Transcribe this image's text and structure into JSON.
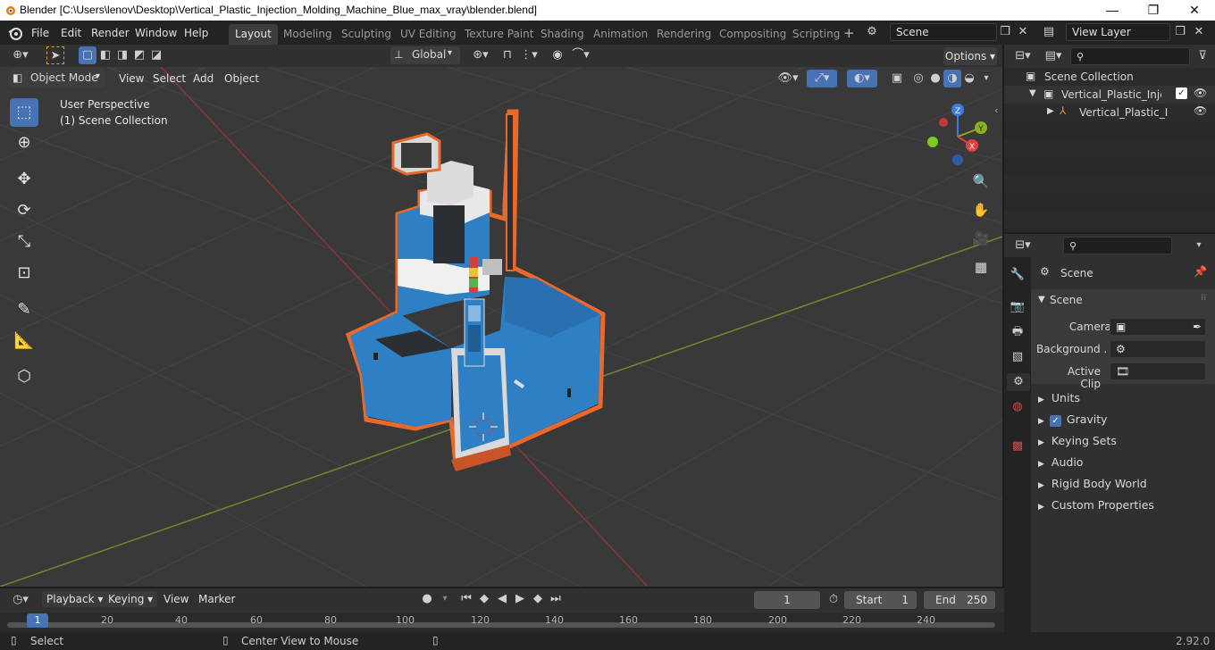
{
  "window": {
    "title": "Blender [C:\\Users\\lenov\\Desktop\\Vertical_Plastic_Injection_Molding_Machine_Blue_max_vray\\blender.blend]",
    "minimize": "—",
    "maximize": "❐",
    "close": "✕"
  },
  "menubar": {
    "items": [
      "File",
      "Edit",
      "Render",
      "Window",
      "Help"
    ]
  },
  "workspaces": [
    "Layout",
    "Modeling",
    "Sculpting",
    "UV Editing",
    "Texture Paint",
    "Shading",
    "Animation",
    "Rendering",
    "Compositing",
    "Scripting"
  ],
  "scene_field": "Scene",
  "view_layer_field": "View Layer",
  "viewport_header": {
    "transform_orientation": "Global",
    "options": "Options",
    "mode": "Object Mode",
    "menus": [
      "View",
      "Select",
      "Add",
      "Object"
    ]
  },
  "viewport": {
    "perspective_label": "User Perspective",
    "collection_label": "(1) Scene Collection",
    "gizmo": {
      "z": "Z",
      "y": "Y",
      "x": "X"
    }
  },
  "outliner": {
    "root": "Scene Collection",
    "collection": "Vertical_Plastic_Injection",
    "object": "Vertical_Plastic_Inje"
  },
  "properties": {
    "context": "Scene",
    "section": "Scene",
    "fields": [
      {
        "label": "Camera",
        "value": ""
      },
      {
        "label": "Background ...",
        "value": ""
      },
      {
        "label": "Active Clip",
        "value": ""
      }
    ],
    "panels": [
      "Units",
      "Gravity",
      "Keying Sets",
      "Audio",
      "Rigid Body World",
      "Custom Properties"
    ],
    "gravity_checked": true
  },
  "timeline": {
    "menus": [
      "Playback",
      "Keying",
      "View",
      "Marker"
    ],
    "current_frame": "1",
    "start_label": "Start",
    "start": "1",
    "end_label": "End",
    "end": "250",
    "ruler_ticks": [
      "1",
      "20",
      "40",
      "60",
      "80",
      "100",
      "120",
      "140",
      "160",
      "180",
      "200",
      "220",
      "240"
    ]
  },
  "statusbar": {
    "select": "Select",
    "center_view": "Center View to Mouse",
    "version": "2.92.0"
  },
  "colors": {
    "accent": "#4772b3",
    "machine_blue": "#2f7fc4",
    "selection_outline": "#e8692a",
    "x_axis": "#b03a3a",
    "y_axis": "#7a9a2a"
  }
}
